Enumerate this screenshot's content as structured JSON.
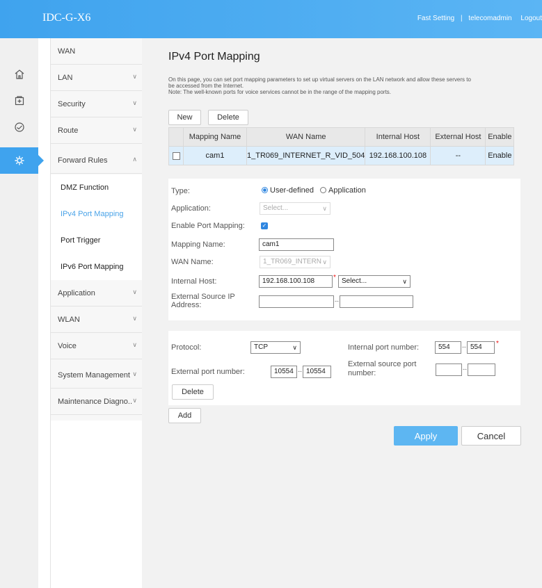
{
  "topbar": {
    "brand": "IDC-G-X6",
    "links": [
      "Fast Setting",
      "telecomadmin",
      "Logout"
    ],
    "separator": "|"
  },
  "iconbar": {
    "icons": [
      "home-icon",
      "plus-box-icon",
      "gauge-icon",
      "gear-icon"
    ]
  },
  "menu": {
    "items": [
      {
        "label": "WAN"
      },
      {
        "label": "LAN"
      },
      {
        "label": "Security"
      },
      {
        "label": "Route"
      },
      {
        "label": "Forward Rules"
      },
      {
        "label": "Application"
      },
      {
        "label": "WLAN"
      },
      {
        "label": "Voice"
      },
      {
        "label": "System Management"
      },
      {
        "label": "Maintenance Diagno.."
      }
    ],
    "subitems": [
      {
        "label": "DMZ Function"
      },
      {
        "label": "IPv4 Port Mapping"
      },
      {
        "label": "Port Trigger"
      },
      {
        "label": "IPv6 Port Mapping"
      }
    ],
    "active_subitem": "IPv4 Port Mapping"
  },
  "page": {
    "title": "IPv4 Port Mapping",
    "desc_line1": "On this page, you can set port mapping parameters to set up virtual servers on the LAN network and allow these servers to",
    "desc_line2": "be accessed from the Internet.",
    "desc_line3": "Note: The well-known ports for voice services cannot be in the range of the mapping ports.",
    "new_button": "New",
    "delete_button": "Delete"
  },
  "table": {
    "headers": [
      "Mapping Name",
      "WAN Name",
      "Internal Host",
      "External Host",
      "Enable"
    ],
    "rows": [
      {
        "mapping_name": "cam1",
        "wan_name": "1_TR069_INTERNET_R_VID_504",
        "internal_host": "192.168.100.108",
        "external_host": "--",
        "enable": "Enable"
      }
    ]
  },
  "form": {
    "type_label": "Type:",
    "type_options": [
      "User-defined",
      "Application"
    ],
    "type_selected": "User-defined",
    "application_label": "Application:",
    "application_placeholder": "Select...",
    "enable_label": "Enable Port Mapping:",
    "enable_checked": true,
    "mapping_name_label": "Mapping Name:",
    "mapping_name_value": "cam1",
    "wan_name_label": "WAN Name:",
    "wan_name_value": "1_TR069_INTERN",
    "internal_host_label": "Internal Host:",
    "internal_host_value": "192.168.100.108",
    "internal_host_select": "Select...",
    "ext_src_ip_label_1": "External Source IP",
    "ext_src_ip_label_2": "Address:",
    "ext_src_ip_from": "",
    "ext_src_ip_to": "",
    "range_sep": "--",
    "required_mark": "*"
  },
  "ports": {
    "protocol_label": "Protocol:",
    "protocol_value": "TCP",
    "internal_port_label": "Internal port number:",
    "internal_port_from": "554",
    "internal_port_to": "554",
    "external_port_label": "External port number:",
    "external_port_from": "10554",
    "external_port_to": "10554",
    "ext_src_port_label_1": "External source port",
    "ext_src_port_label_2": "number:",
    "ext_src_port_from": "",
    "ext_src_port_to": "",
    "delete_button": "Delete",
    "add_button": "Add"
  },
  "actions": {
    "apply": "Apply",
    "cancel": "Cancel"
  },
  "colors": {
    "accent": "#3fa3ee",
    "active_row": "#ddeefb",
    "active_submenu": "#4aa3e8",
    "required": "#e11111"
  }
}
